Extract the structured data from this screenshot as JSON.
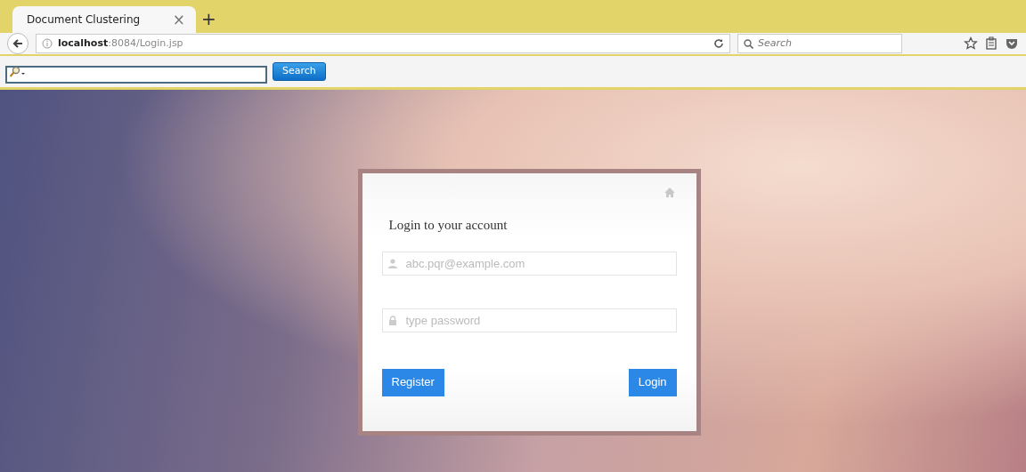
{
  "browser": {
    "tab": {
      "title": "Document Clustering",
      "close": "×",
      "new_tab": "+",
      "selected": true
    },
    "address": {
      "url": "**localhost**:8084/Login.jsp"
    },
    "search": {
      "placeholder": "Search"
    }
  },
  "toolbar": {
    "button": "Search"
  },
  "login": {
    "title": "Login to your account",
    "fields": [
      {
        "kind": "email",
        "placeholder": "abc.pqr@example.com"
      },
      {
        "kind": "password",
        "placeholder": "type password"
      }
    ],
    "buttons": [
      "Register",
      "Login"
    ]
  }
}
